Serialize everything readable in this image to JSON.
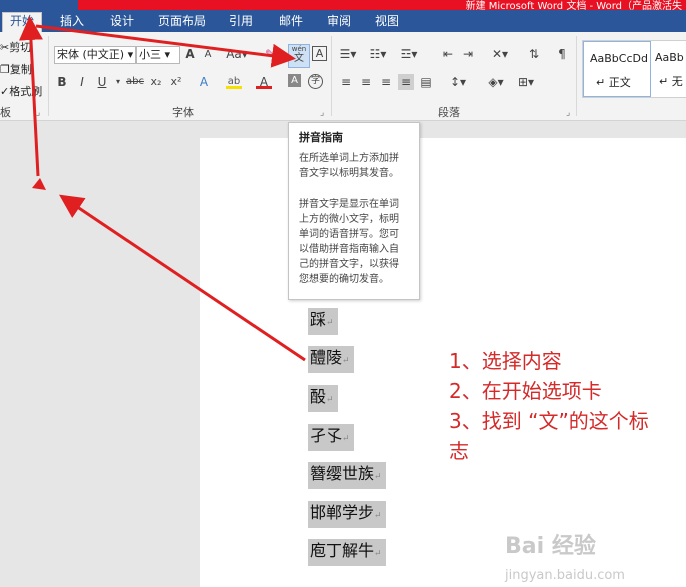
{
  "titlebar": {
    "title": "新建 Microsoft Word 文档 - Word（产品激活失"
  },
  "tabs": [
    "开始",
    "插入",
    "设计",
    "页面布局",
    "引用",
    "邮件",
    "审阅",
    "视图"
  ],
  "clipboard": {
    "cut": "剪切",
    "copy": "复制",
    "format_painter": "格式刷",
    "group_label": "板"
  },
  "font": {
    "font_name": "宋体 (中文正)",
    "font_size": "小三",
    "group_label": "字体",
    "grow": "A",
    "shrink": "A",
    "case": "Aa",
    "phonetic_top": "wén",
    "phonetic_bottom": "文",
    "border_char": "A",
    "bold": "B",
    "italic": "I",
    "underline": "U",
    "strike": "abc",
    "sub": "x₂",
    "sup": "x²",
    "effects": "A",
    "highlight": "ab",
    "color": "A",
    "shade": "A",
    "enclose": "字"
  },
  "paragraph": {
    "group_label": "段落"
  },
  "styles": {
    "style1_preview": "AaBbCcDd",
    "style1_name": "正文",
    "style2_preview": "AaBb",
    "style2_name": "无"
  },
  "tooltip": {
    "title": "拼音指南",
    "body1": [
      "在所选单词上方添加拼",
      "音文字以标明其发音。"
    ],
    "body2": [
      "拼音文字是显示在单词",
      "上方的微小文字，标明",
      "单词的语音拼写。您可",
      "以借助拼音指南输入自",
      "己的拼音文字，以获得",
      "您想要的确切发音。"
    ]
  },
  "document_lines": [
    "踩",
    "醴陵",
    "酘",
    "孑孓",
    "簪缨世族",
    "邯郸学步",
    "庖丁解牛"
  ],
  "paragraph_mark": "↵",
  "instructions": [
    "1、选择内容",
    "2、在开始选项卡",
    "3、找到 “文”的这个标",
    "志"
  ],
  "watermark": {
    "main": "Bai 经验",
    "sub": "jingyan.baidu.com"
  },
  "colors": {
    "ribbon_blue": "#2b579a",
    "arrow_red": "#e02020",
    "instruction_red": "#d42a2a",
    "highlight_gray": "#c8c8c8"
  }
}
